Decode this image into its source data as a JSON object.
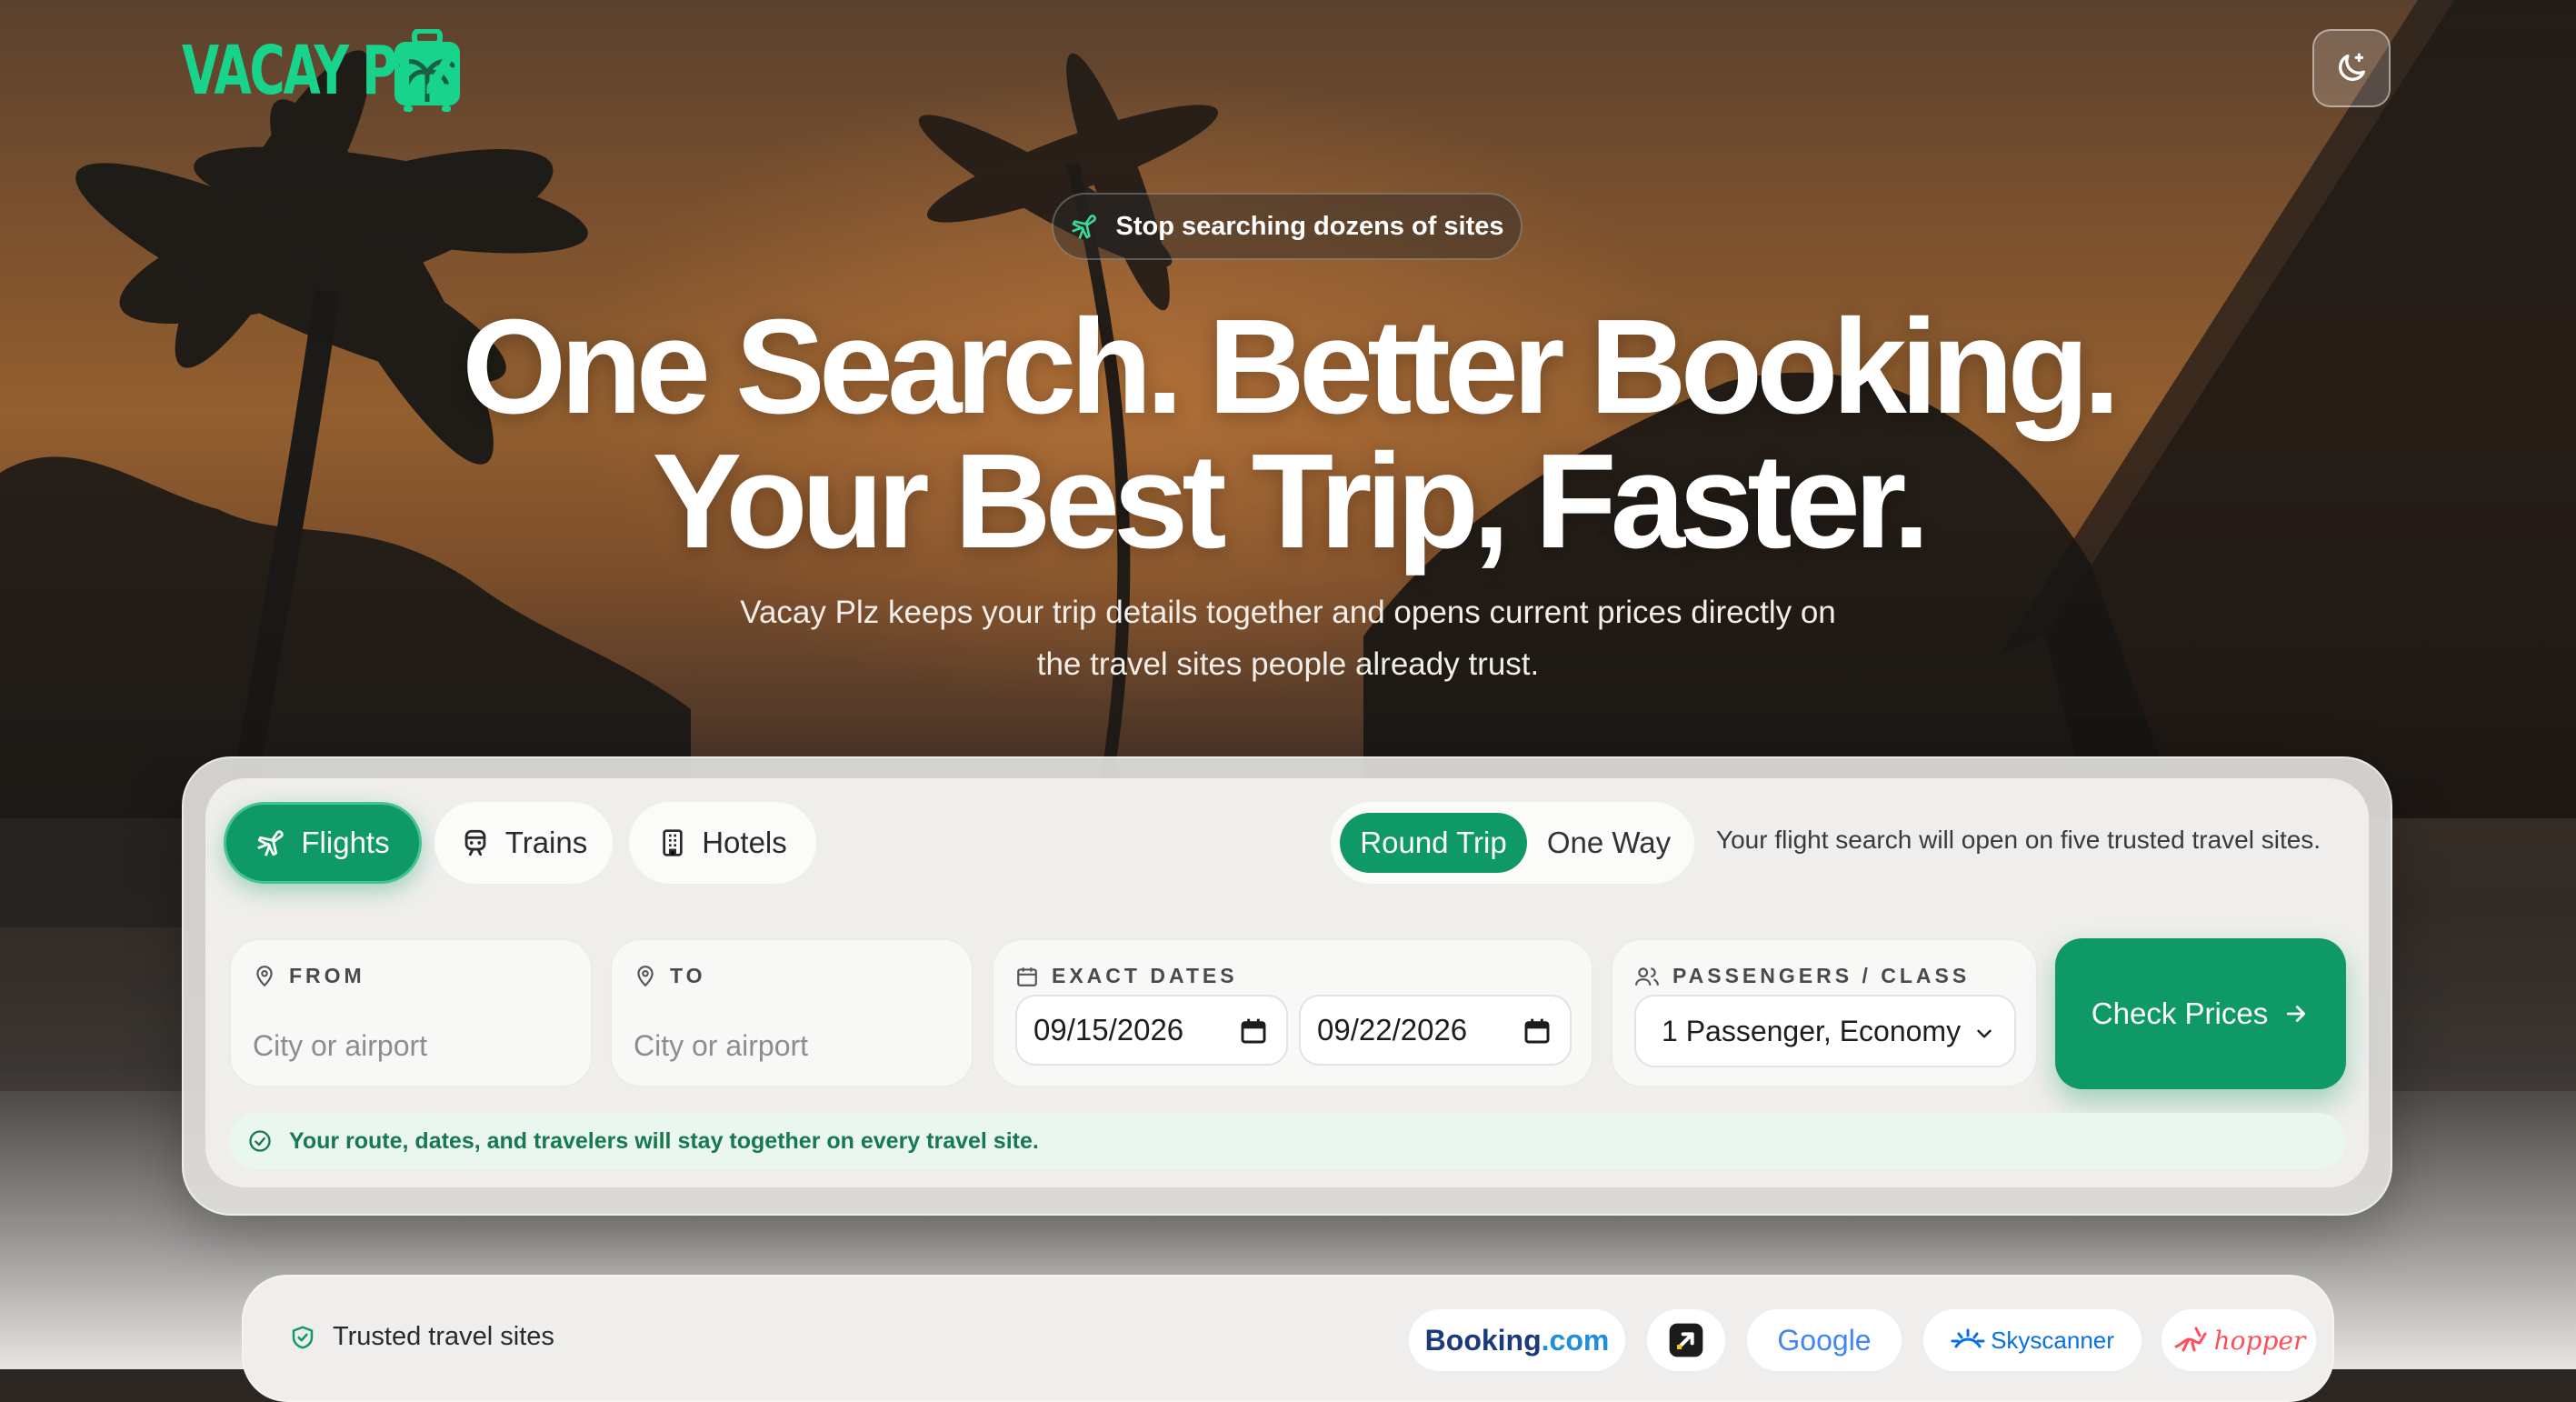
{
  "brand": {
    "logo_text": "VACAY PLZ",
    "accent": "#18d38b",
    "primary": "#0f9966"
  },
  "header": {
    "theme_toggle_icon": "moon-sparkle-icon"
  },
  "hero": {
    "pill_icon": "plane-icon",
    "pill_text": "Stop searching dozens of sites",
    "headline_line1": "One Search. Better Booking.",
    "headline_line2": "Your Best Trip, Faster.",
    "subtext_line1": "Vacay Plz keeps your trip details together and opens current prices directly on",
    "subtext_line2": "the travel sites people already trust."
  },
  "search": {
    "modes": [
      {
        "label": "Flights",
        "icon": "plane-icon",
        "active": true
      },
      {
        "label": "Trains",
        "icon": "train-icon",
        "active": false
      },
      {
        "label": "Hotels",
        "icon": "building-icon",
        "active": false
      }
    ],
    "trip_types": [
      {
        "label": "Round Trip",
        "active": true
      },
      {
        "label": "One Way",
        "active": false
      }
    ],
    "note": "Your flight search will open on five trusted travel sites.",
    "from": {
      "label": "FROM",
      "placeholder": "City or airport",
      "value": ""
    },
    "to": {
      "label": "TO",
      "placeholder": "City or airport",
      "value": ""
    },
    "dates": {
      "label": "EXACT DATES",
      "depart": "09/15/2026",
      "return": "09/22/2026"
    },
    "passengers": {
      "label": "PASSENGERS / CLASS",
      "value": "1 Passenger, Economy"
    },
    "submit_label": "Check Prices",
    "info": "Your route, dates, and travelers will stay together on every travel site."
  },
  "trusted": {
    "label": "Trusted travel sites",
    "partners": [
      {
        "name": "Booking.com",
        "part1": "Booking",
        "part2": ".com"
      },
      {
        "name": "Expedia",
        "icon": "arrow-logo-icon"
      },
      {
        "name": "Google"
      },
      {
        "name": "Skyscanner"
      },
      {
        "name": "hopper"
      }
    ]
  }
}
